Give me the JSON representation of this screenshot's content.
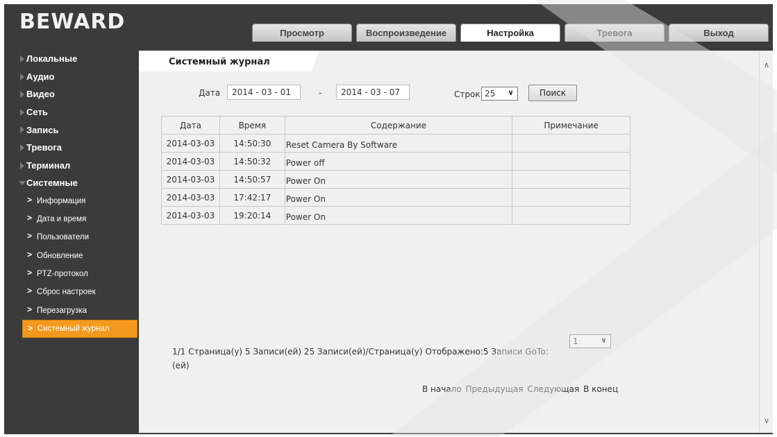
{
  "brand": {
    "logo_text": "BEWARD"
  },
  "nav": {
    "tabs": [
      {
        "label": "Просмотр",
        "active": false
      },
      {
        "label": "Воспроизведение",
        "active": false
      },
      {
        "label": "Настройка",
        "active": true
      },
      {
        "label": "Тревога",
        "active": false
      },
      {
        "label": "Выход",
        "active": false
      }
    ]
  },
  "sidebar": {
    "sections": [
      {
        "label": "Локальные"
      },
      {
        "label": "Аудио"
      },
      {
        "label": "Видео"
      },
      {
        "label": "Сеть"
      },
      {
        "label": "Запись"
      },
      {
        "label": "Тревога"
      },
      {
        "label": "Терминал"
      },
      {
        "label": "Системные",
        "expanded": true
      }
    ],
    "sub_items": [
      {
        "label": "Информация"
      },
      {
        "label": "Дата и время"
      },
      {
        "label": "Пользователи"
      },
      {
        "label": "Обновление"
      },
      {
        "label": "PTZ-протокол"
      },
      {
        "label": "Сброс настроек"
      },
      {
        "label": "Перезагрузка"
      },
      {
        "label": "Системный журнал",
        "active": true
      }
    ]
  },
  "page": {
    "title": "Системный журнал",
    "date_label": "Дата",
    "date_from": "2014 - 03 - 01",
    "date_sep": "-",
    "date_to": "2014 - 03 - 07",
    "rows_label": "Строк",
    "rows_value": "25",
    "search_label": "Поиск"
  },
  "log_table": {
    "headers": [
      "Дата",
      "Время",
      "Содержание",
      "Примечание"
    ],
    "rows": [
      [
        "2014-03-03",
        "14:50:30",
        "Reset Camera By Software",
        ""
      ],
      [
        "2014-03-03",
        "14:50:32",
        "Power off",
        ""
      ],
      [
        "2014-03-03",
        "14:50:57",
        "Power On",
        ""
      ],
      [
        "2014-03-03",
        "17:42:17",
        "Power On",
        ""
      ],
      [
        "2014-03-03",
        "19:20:14",
        "Power On",
        ""
      ]
    ]
  },
  "pager": {
    "summary": "1/1 Страница(у) 5 Записи(ей) 25 Записи(ей)/Страница(у) Отображено:5 Записи  GoTo:",
    "summary_wrap": "(ей)",
    "goto_value": "1",
    "first": "В начало",
    "prev": "Предыдущая",
    "next": "Следующая",
    "last": "В конец"
  },
  "colors": {
    "frame": "#3b3b3b",
    "content_bg": "#f0f0f0",
    "active_item": "#f39a1e"
  }
}
